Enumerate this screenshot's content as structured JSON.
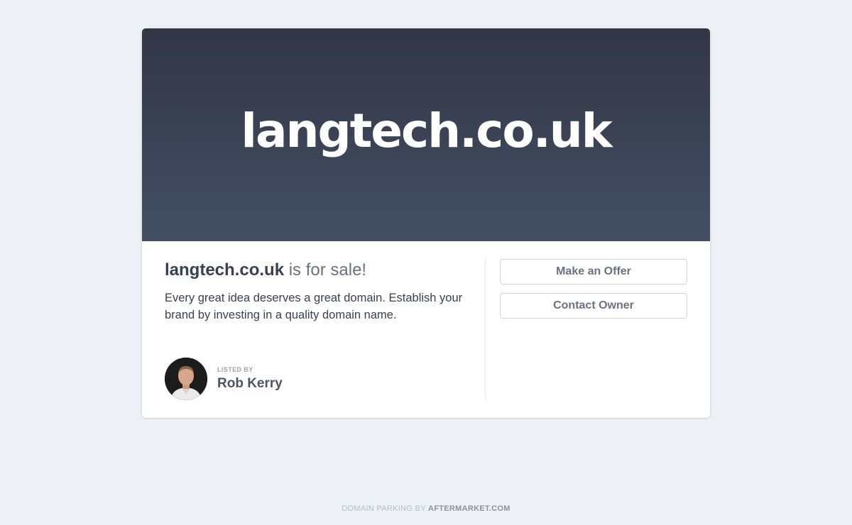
{
  "hero": {
    "domain": "langtech.co.uk"
  },
  "sale": {
    "domain": "langtech.co.uk",
    "suffix": " is for sale!",
    "description": "Every great idea deserves a great domain. Establish your brand by investing in a quality domain name."
  },
  "seller": {
    "listed_by": "LISTED BY",
    "name": "Rob Kerry"
  },
  "actions": {
    "offer_label": "Make an Offer",
    "contact_label": "Contact Owner"
  },
  "footer": {
    "prefix": "DOMAIN PARKING BY ",
    "brand": "AFTERMARKET.COM"
  },
  "colors": {
    "page_bg": "#edf0f5",
    "hero_top": "#323646",
    "hero_bottom": "#434f62",
    "text_dark": "#374151",
    "text_muted": "#6b7280"
  }
}
